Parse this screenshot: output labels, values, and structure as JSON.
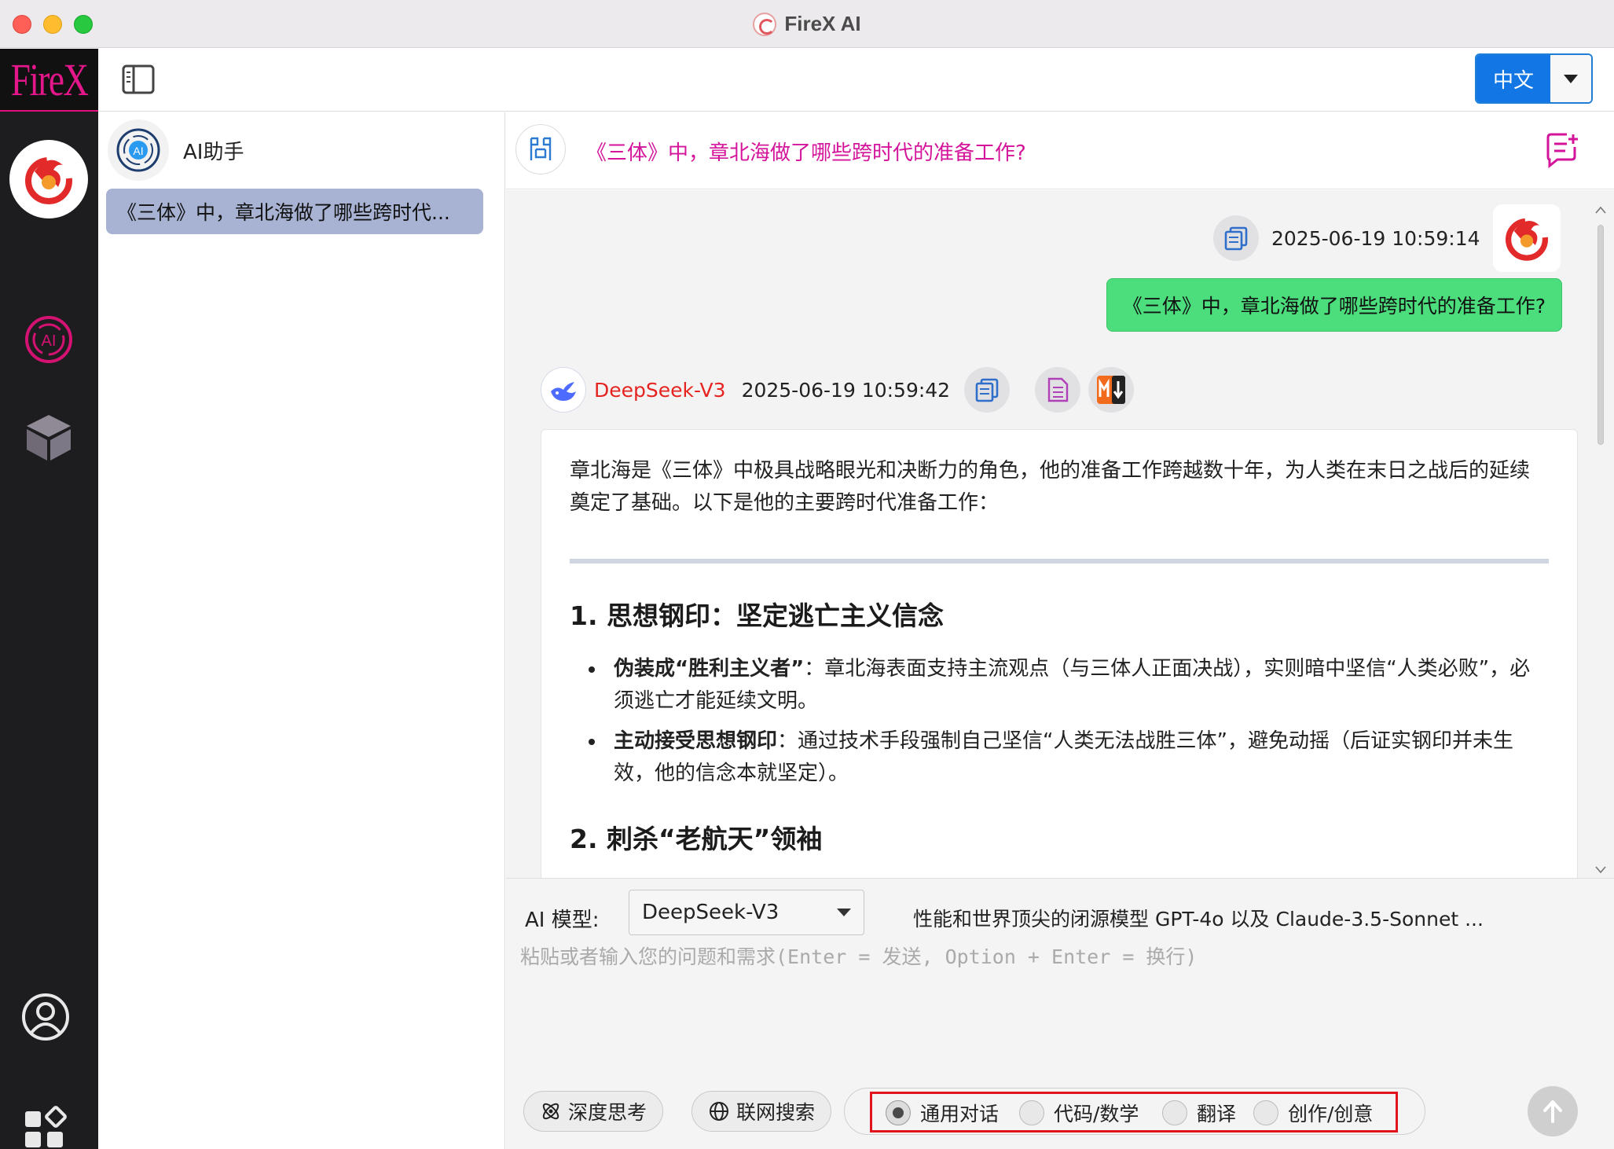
{
  "window": {
    "title": "FireX AI"
  },
  "rail": {
    "brand": "FireX",
    "items": [
      {
        "icon": "dragon-icon"
      },
      {
        "icon": "ai-assistant-icon"
      },
      {
        "icon": "cube-icon"
      },
      {
        "icon": "user-profile-icon"
      },
      {
        "icon": "apps-grid-icon"
      }
    ]
  },
  "toolbar": {
    "language": "中文"
  },
  "list": {
    "assistant_name": "AI助手",
    "conversations": [
      {
        "title": "《三体》中，章北海做了哪些跨时代..."
      }
    ]
  },
  "chat": {
    "header_title": "《三体》中，章北海做了哪些跨时代的准备工作?",
    "user_message": {
      "timestamp": "2025-06-19 10:59:14",
      "text": "《三体》中，章北海做了哪些跨时代的准备工作?"
    },
    "ai_message": {
      "model": "DeepSeek-V3",
      "timestamp": "2025-06-19 10:59:42",
      "intro": "章北海是《三体》中极具战略眼光和决断力的角色，他的准备工作跨越数十年，为人类在末日之战后的延续奠定了基础。以下是他的主要跨时代准备工作：",
      "section1_heading": "1. 思想钢印：坚定逃亡主义信念",
      "bullets": [
        {
          "bold": "伪装成“胜利主义者”",
          "text": "：章北海表面支持主流观点（与三体人正面决战），实则暗中坚信“人类必败”，必须逃亡才能延续文明。"
        },
        {
          "bold": "主动接受思想钢印",
          "text": "：通过技术手段强制自己坚信“人类无法战胜三体”，避免动摇（后证实钢印并未生效，他的信念本就坚定）。"
        }
      ],
      "section2_heading": "2. 刺杀“老航天”领袖"
    }
  },
  "composer": {
    "model_label": "AI 模型:",
    "model_value": "DeepSeek-V3",
    "model_description": "性能和世界顶尖的闭源模型 GPT-4o 以及 Claude-3.5-Sonnet ...",
    "placeholder": "粘贴或者输入您的问题和需求(Enter = 发送, Option + Enter = 换行)",
    "deep_think_label": "深度思考",
    "web_search_label": "联网搜索",
    "modes": [
      {
        "label": "通用对话",
        "selected": true
      },
      {
        "label": "代码/数学",
        "selected": false
      },
      {
        "label": "翻译",
        "selected": false
      },
      {
        "label": "创作/创意",
        "selected": false
      }
    ]
  },
  "colors": {
    "brand_pink": "#e3178a",
    "accent_blue": "#1277e4",
    "user_bubble": "#4cde7d",
    "highlight_red": "#e0141c"
  }
}
